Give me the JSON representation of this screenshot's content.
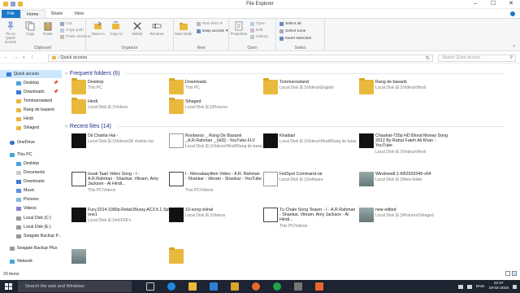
{
  "window": {
    "title": "File Explorer",
    "controls": [
      "–",
      "☐",
      "✕"
    ]
  },
  "ribbon_tabs": [
    "File",
    "Home",
    "Share",
    "View"
  ],
  "ribbon": {
    "clipboard": {
      "label": "Clipboard",
      "pin": "Pin to Quick access",
      "copy": "Copy",
      "paste": "Paste",
      "cut": "Cut",
      "copy_path": "Copy path",
      "paste_shortcut": "Paste shortcut"
    },
    "organize": {
      "label": "Organize",
      "move_to": "Move to",
      "copy_to": "Copy to",
      "delete": "Delete",
      "rename": "Rename"
    },
    "new": {
      "label": "New",
      "new_folder": "New folder",
      "new_item": "New item",
      "easy_access": "Easy access"
    },
    "open": {
      "label": "Open",
      "properties": "Properties",
      "open": "Open",
      "edit": "Edit",
      "history": "History"
    },
    "select": {
      "label": "Select",
      "select_all": "Select all",
      "select_none": "Select none",
      "invert": "Invert selection"
    }
  },
  "address": {
    "path": "Quick access",
    "search_placeholder": "Search Quick access"
  },
  "nav": [
    {
      "label": "Quick access",
      "icon": "star-icon",
      "pinned": false
    },
    {
      "label": "Desktop",
      "icon": "desktop-icon",
      "pinned": true
    },
    {
      "label": "Downloads",
      "icon": "download-icon",
      "pinned": true
    },
    {
      "label": "Tommarowland",
      "icon": "folder-icon",
      "pinned": false
    },
    {
      "label": "Rang de basanti",
      "icon": "folder-icon",
      "pinned": false
    },
    {
      "label": "Hindi",
      "icon": "folder-icon",
      "pinned": false
    },
    {
      "label": "Sihaged",
      "icon": "folder-icon",
      "pinned": false
    },
    {
      "label": "OneDrive",
      "icon": "cloud-icon",
      "pinned": false
    },
    {
      "label": "This PC",
      "icon": "computer-icon",
      "pinned": false
    },
    {
      "label": "Desktop",
      "icon": "desktop-icon",
      "pinned": false
    },
    {
      "label": "Documents",
      "icon": "documents-icon",
      "pinned": false
    },
    {
      "label": "Downloads",
      "icon": "download-icon",
      "pinned": false
    },
    {
      "label": "Music",
      "icon": "music-icon",
      "pinned": false
    },
    {
      "label": "Pictures",
      "icon": "pictures-icon",
      "pinned": false
    },
    {
      "label": "Videos",
      "icon": "videos-icon",
      "pinned": false
    },
    {
      "label": "Local Disk (C:)",
      "icon": "drive-icon",
      "pinned": false
    },
    {
      "label": "Local Disk (E:)",
      "icon": "drive-icon",
      "pinned": false
    },
    {
      "label": "Seagate Backup P...",
      "icon": "drive-icon",
      "pinned": false
    },
    {
      "label": "Seagate Backup Plus",
      "icon": "drive-icon",
      "pinned": false
    },
    {
      "label": "Network",
      "icon": "network-icon",
      "pinned": false
    }
  ],
  "frequent_header": "Frequent folders (6)",
  "frequent": [
    {
      "name": "Desktop",
      "sub": "This PC",
      "kind": "folder"
    },
    {
      "name": "Downloads",
      "sub": "This PC",
      "kind": "folder"
    },
    {
      "name": "Tommarowland",
      "sub": "Local Disk (E:)\\Videos\\English",
      "kind": "folder"
    },
    {
      "name": "Rang de basanti",
      "sub": "Local Disk (E:)\\Videos\\Hindi",
      "kind": "folder"
    },
    {
      "name": "Hindi",
      "sub": "Local Disk (E:)\\Videos",
      "kind": "folder"
    },
    {
      "name": "Sihaged",
      "sub": "Local Disk (E:)\\Pictures",
      "kind": "folder"
    }
  ],
  "recent_header": "Recent files (14)",
  "recent": [
    {
      "name": "Dil Chahta Hai -",
      "sub": "Local Disk (E:)\\Videos\\Dil chahta hai",
      "kind": "vlc"
    },
    {
      "name": "Roobaroo _ Rang De Basanti _A.R.Rahman _ [HD] - YouTube.FLV",
      "sub": "Local Disk (E:)\\Videos\\Hindi\\Rang de basanti",
      "kind": "doc"
    },
    {
      "name": "Khalbali",
      "sub": "Local Disk (E:)\\Videos\\Hindi\\Rang de basanti",
      "kind": "vlc"
    },
    {
      "name": "Chaahat-720p HD Blood Money Song 2012 By Rahat Fateh Ali Khan - YouTube",
      "sub": "Local Disk (E:)\\Videos\\Hindi",
      "kind": "vlc"
    },
    {
      "name": "Issak Taari Video Song - I - A.R.Rahman - Shankar, Vikram, Amy Jackson - Ai Hindi...",
      "sub": "This PC\\Videos",
      "kind": "m321"
    },
    {
      "name": "I - Mersalaayitten Video - A.R. Rahman - Shankar - Vikram - Shankar - YouTube",
      "sub": "This PC\\Videos",
      "kind": "m321"
    },
    {
      "name": "HotSpot Command.rar",
      "sub": "Local Disk (E:)\\Software",
      "kind": "doc"
    },
    {
      "name": "Windows8.1-KB2932046-x64",
      "sub": "Local Disk (E:)\\New folder",
      "kind": "pic"
    },
    {
      "name": "Fury.2014.1080p.Retail.Bluray.AC3.5.1.Sphinct one1",
      "sub": "Local Disk (E:)\\mOVIE's",
      "kind": "vlc"
    },
    {
      "name": "10-song vishal",
      "sub": "Local Disk (E:)\\Videos",
      "kind": "vlc"
    },
    {
      "name": "Tu Chale Song Teaser - I - A.R.Rahman - Shankar, Vikram, Amy Jackson - Ai Hindi...",
      "sub": "This PC\\Videos",
      "kind": "m321"
    },
    {
      "name": "new edited",
      "sub": "Local Disk (E:)\\Pictures\\Sihaged",
      "kind": "pic"
    },
    {
      "name": "",
      "sub": "",
      "kind": "pic"
    },
    {
      "name": "",
      "sub": "",
      "kind": "zip"
    }
  ],
  "status": {
    "count": "20 items"
  },
  "taskbar": {
    "search_placeholder": "Search the web and Windows",
    "lang": "ENG",
    "time": "22:37",
    "date": "19-02-2015"
  },
  "colors": {
    "accent": "#1979ca",
    "selected": "#cce8ff",
    "folder": "#e8b93c",
    "taskbar": "#1d2330",
    "section_header": "#1e3287"
  }
}
